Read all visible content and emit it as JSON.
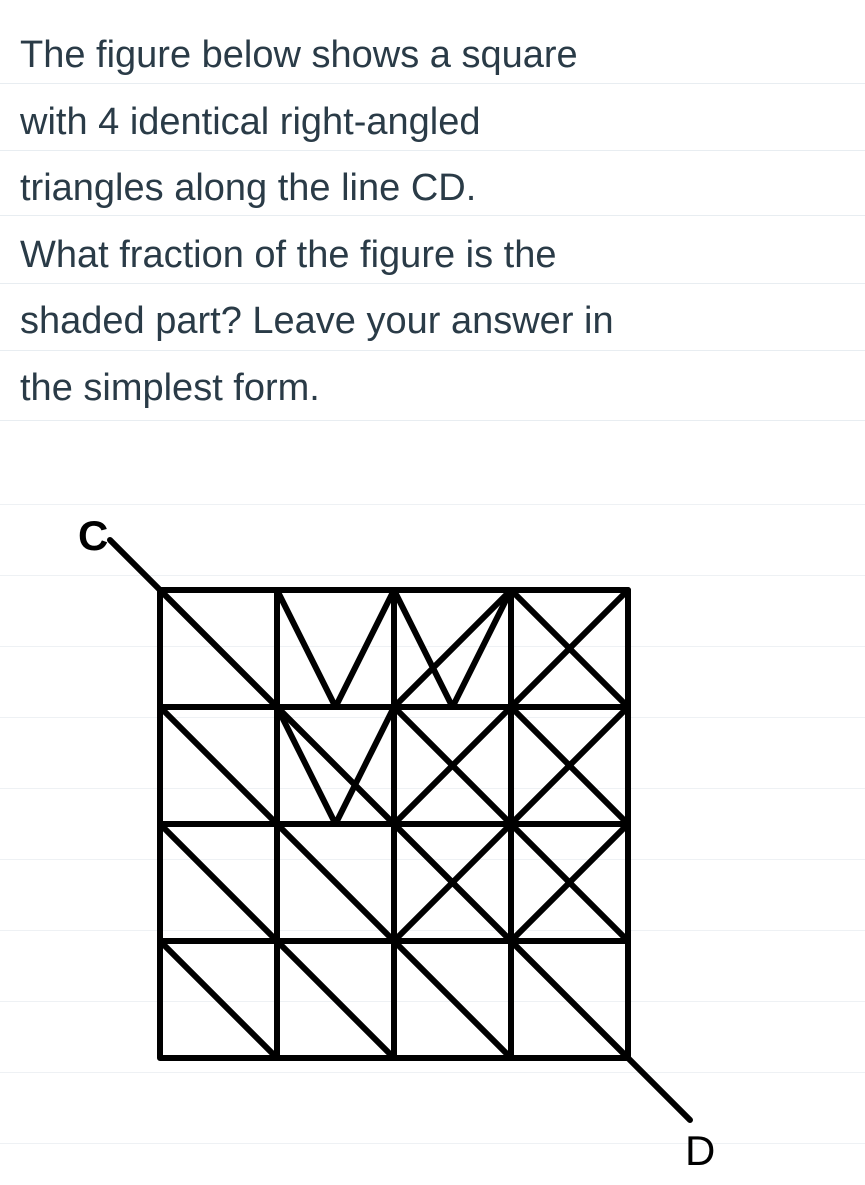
{
  "problem": {
    "line1": "The figure  below shows a square",
    "line2": "with 4 identical right-angled",
    "line3": "triangles along the line CD.",
    "line4": "What fraction of the figure is the",
    "line5": "shaded part? Leave your answer in",
    "line6": "the simplest form."
  },
  "figure": {
    "labelC": "C",
    "labelD": "D"
  }
}
